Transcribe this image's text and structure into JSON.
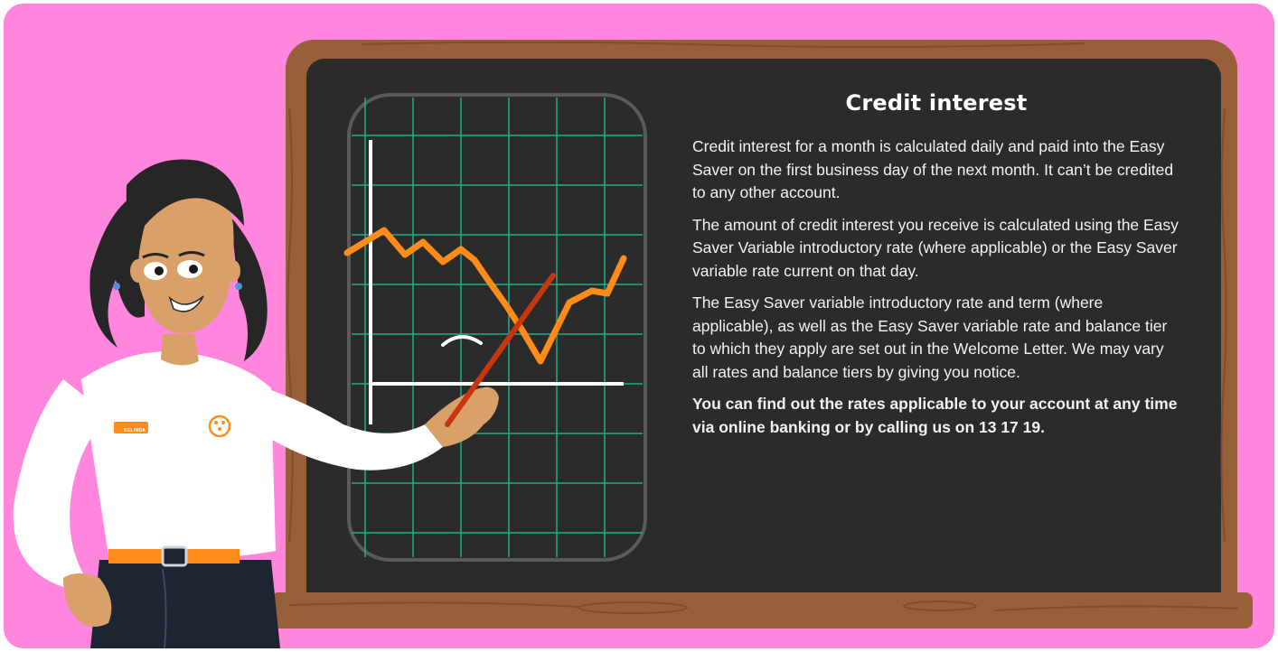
{
  "heading": "Credit interest",
  "paragraphs": [
    "Credit interest for a month is calculated daily and paid into the Easy Saver on the first business day of the next month. It can’t be credited to any other account.",
    "The amount of credit interest you receive is calculated using the Easy Saver Variable introductory rate (where applicable) or the Easy Saver variable rate current on that day.",
    "The Easy Saver variable introductory rate and term (where applicable), as well as the Easy Saver variable rate and balance tier to which they apply are set out in the Welcome Letter. We may vary all rates and balance tiers by giving you notice."
  ],
  "bold_note": "You can find out the rates applicable to your account at any time via online banking or by calling us on 13 17 19.",
  "badge_name": "BELINDA",
  "colors": {
    "background": "#ff85dd",
    "board": "#2b2b2b",
    "wood": "#98603a",
    "grid": "#1fae86",
    "line": "#ff8c1a",
    "pointer": "#c8360f"
  },
  "illustration": {
    "character": "teacher-with-pointer",
    "chart_icon": "zigzag-line-graph",
    "logo_icon": "bank-logo-icon"
  }
}
